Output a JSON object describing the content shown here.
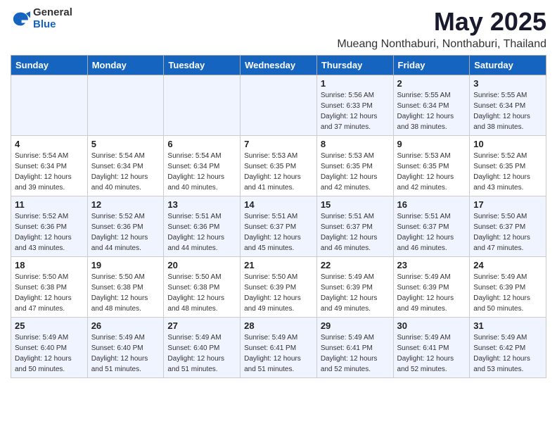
{
  "header": {
    "logo_general": "General",
    "logo_blue": "Blue",
    "month_title": "May 2025",
    "location": "Mueang Nonthaburi, Nonthaburi, Thailand"
  },
  "weekdays": [
    "Sunday",
    "Monday",
    "Tuesday",
    "Wednesday",
    "Thursday",
    "Friday",
    "Saturday"
  ],
  "weeks": [
    [
      {
        "day": "",
        "info": ""
      },
      {
        "day": "",
        "info": ""
      },
      {
        "day": "",
        "info": ""
      },
      {
        "day": "",
        "info": ""
      },
      {
        "day": "1",
        "info": "Sunrise: 5:56 AM\nSunset: 6:33 PM\nDaylight: 12 hours\nand 37 minutes."
      },
      {
        "day": "2",
        "info": "Sunrise: 5:55 AM\nSunset: 6:34 PM\nDaylight: 12 hours\nand 38 minutes."
      },
      {
        "day": "3",
        "info": "Sunrise: 5:55 AM\nSunset: 6:34 PM\nDaylight: 12 hours\nand 38 minutes."
      }
    ],
    [
      {
        "day": "4",
        "info": "Sunrise: 5:54 AM\nSunset: 6:34 PM\nDaylight: 12 hours\nand 39 minutes."
      },
      {
        "day": "5",
        "info": "Sunrise: 5:54 AM\nSunset: 6:34 PM\nDaylight: 12 hours\nand 40 minutes."
      },
      {
        "day": "6",
        "info": "Sunrise: 5:54 AM\nSunset: 6:34 PM\nDaylight: 12 hours\nand 40 minutes."
      },
      {
        "day": "7",
        "info": "Sunrise: 5:53 AM\nSunset: 6:35 PM\nDaylight: 12 hours\nand 41 minutes."
      },
      {
        "day": "8",
        "info": "Sunrise: 5:53 AM\nSunset: 6:35 PM\nDaylight: 12 hours\nand 42 minutes."
      },
      {
        "day": "9",
        "info": "Sunrise: 5:53 AM\nSunset: 6:35 PM\nDaylight: 12 hours\nand 42 minutes."
      },
      {
        "day": "10",
        "info": "Sunrise: 5:52 AM\nSunset: 6:35 PM\nDaylight: 12 hours\nand 43 minutes."
      }
    ],
    [
      {
        "day": "11",
        "info": "Sunrise: 5:52 AM\nSunset: 6:36 PM\nDaylight: 12 hours\nand 43 minutes."
      },
      {
        "day": "12",
        "info": "Sunrise: 5:52 AM\nSunset: 6:36 PM\nDaylight: 12 hours\nand 44 minutes."
      },
      {
        "day": "13",
        "info": "Sunrise: 5:51 AM\nSunset: 6:36 PM\nDaylight: 12 hours\nand 44 minutes."
      },
      {
        "day": "14",
        "info": "Sunrise: 5:51 AM\nSunset: 6:37 PM\nDaylight: 12 hours\nand 45 minutes."
      },
      {
        "day": "15",
        "info": "Sunrise: 5:51 AM\nSunset: 6:37 PM\nDaylight: 12 hours\nand 46 minutes."
      },
      {
        "day": "16",
        "info": "Sunrise: 5:51 AM\nSunset: 6:37 PM\nDaylight: 12 hours\nand 46 minutes."
      },
      {
        "day": "17",
        "info": "Sunrise: 5:50 AM\nSunset: 6:37 PM\nDaylight: 12 hours\nand 47 minutes."
      }
    ],
    [
      {
        "day": "18",
        "info": "Sunrise: 5:50 AM\nSunset: 6:38 PM\nDaylight: 12 hours\nand 47 minutes."
      },
      {
        "day": "19",
        "info": "Sunrise: 5:50 AM\nSunset: 6:38 PM\nDaylight: 12 hours\nand 48 minutes."
      },
      {
        "day": "20",
        "info": "Sunrise: 5:50 AM\nSunset: 6:38 PM\nDaylight: 12 hours\nand 48 minutes."
      },
      {
        "day": "21",
        "info": "Sunrise: 5:50 AM\nSunset: 6:39 PM\nDaylight: 12 hours\nand 49 minutes."
      },
      {
        "day": "22",
        "info": "Sunrise: 5:49 AM\nSunset: 6:39 PM\nDaylight: 12 hours\nand 49 minutes."
      },
      {
        "day": "23",
        "info": "Sunrise: 5:49 AM\nSunset: 6:39 PM\nDaylight: 12 hours\nand 49 minutes."
      },
      {
        "day": "24",
        "info": "Sunrise: 5:49 AM\nSunset: 6:39 PM\nDaylight: 12 hours\nand 50 minutes."
      }
    ],
    [
      {
        "day": "25",
        "info": "Sunrise: 5:49 AM\nSunset: 6:40 PM\nDaylight: 12 hours\nand 50 minutes."
      },
      {
        "day": "26",
        "info": "Sunrise: 5:49 AM\nSunset: 6:40 PM\nDaylight: 12 hours\nand 51 minutes."
      },
      {
        "day": "27",
        "info": "Sunrise: 5:49 AM\nSunset: 6:40 PM\nDaylight: 12 hours\nand 51 minutes."
      },
      {
        "day": "28",
        "info": "Sunrise: 5:49 AM\nSunset: 6:41 PM\nDaylight: 12 hours\nand 51 minutes."
      },
      {
        "day": "29",
        "info": "Sunrise: 5:49 AM\nSunset: 6:41 PM\nDaylight: 12 hours\nand 52 minutes."
      },
      {
        "day": "30",
        "info": "Sunrise: 5:49 AM\nSunset: 6:41 PM\nDaylight: 12 hours\nand 52 minutes."
      },
      {
        "day": "31",
        "info": "Sunrise: 5:49 AM\nSunset: 6:42 PM\nDaylight: 12 hours\nand 53 minutes."
      }
    ]
  ]
}
